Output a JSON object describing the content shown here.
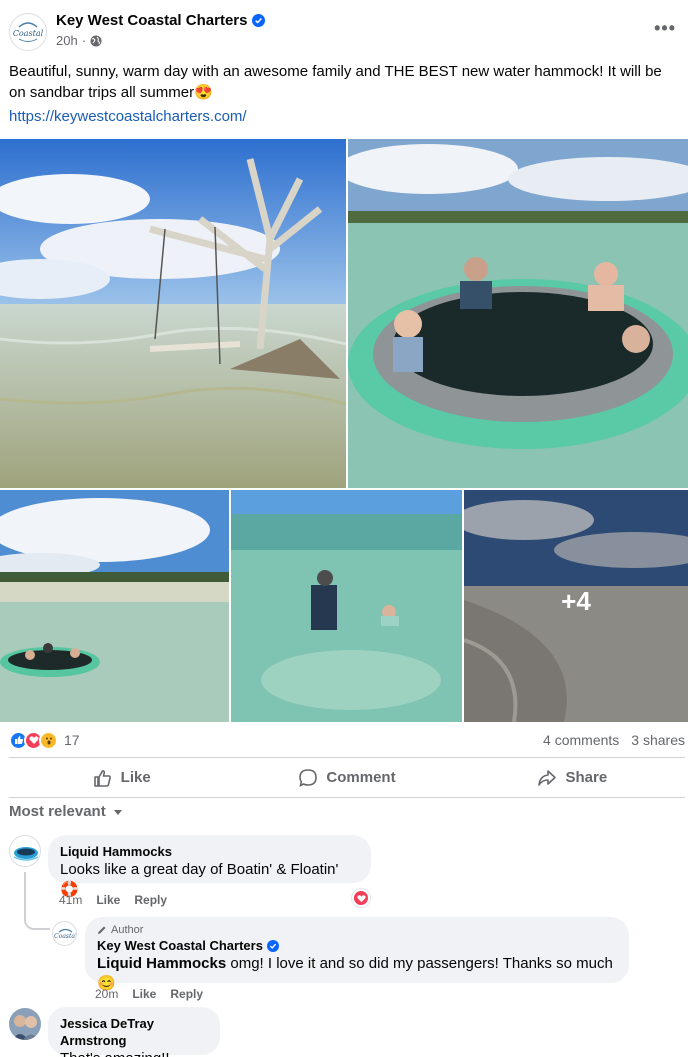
{
  "post": {
    "page_name": "Key West Coastal Charters",
    "time": "20h",
    "time_separator": "·",
    "text": "Beautiful, sunny, warm day with an awesome family and THE BEST new water hammock! It will be on sandbar trips all summer",
    "text_emoji": "😍",
    "link": "https://keywestcoastalcharters.com/",
    "more_photos": "+4",
    "logo_text": "Coastal"
  },
  "reactions": {
    "count": "17",
    "comments": "4 comments",
    "shares": "3 shares"
  },
  "actions": {
    "like": "Like",
    "comment": "Comment",
    "share": "Share"
  },
  "sort_label": "Most relevant",
  "comments": [
    {
      "author": "Liquid Hammocks",
      "text": "Looks like a great day of Boatin' & Floatin'",
      "emoji": "🛟",
      "time": "41m",
      "like": "Like",
      "reply": "Reply"
    },
    {
      "badge": "Author",
      "author": "Key West Coastal Charters",
      "mention": "Liquid Hammocks",
      "text": " omg! I love it and so did my passengers! Thanks so much",
      "emoji": "😊",
      "time": "20m",
      "like": "Like",
      "reply": "Reply"
    },
    {
      "author": "Jessica DeTray Armstrong",
      "text": "That's amazing!!"
    }
  ],
  "colors": {
    "link": "#1a5db4",
    "verified": "#0866ff",
    "muted": "#65676b",
    "bubble": "#f0f2f5"
  }
}
